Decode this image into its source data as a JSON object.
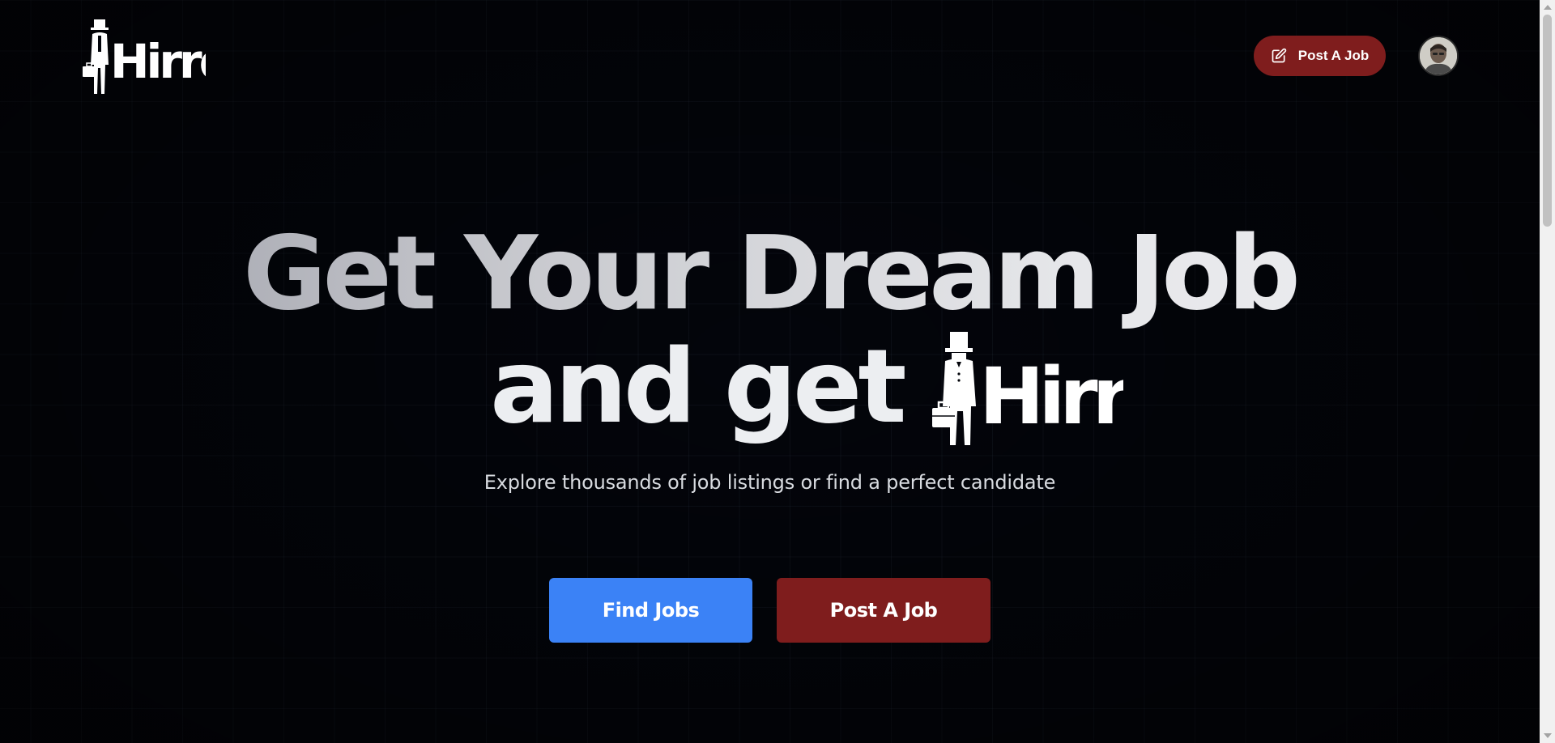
{
  "header": {
    "logo_text": "Hirrd",
    "post_job_label": "Post A Job"
  },
  "hero": {
    "headline_line1": "Get Your Dream Job",
    "headline_line2": "and get",
    "logo_text": "Hirrd",
    "subtitle": "Explore thousands of job listings or find a perfect candidate"
  },
  "actions": {
    "find_jobs_label": "Find Jobs",
    "post_job_label": "Post A Job"
  },
  "colors": {
    "background": "#03050b",
    "primary_blue": "#3b82f6",
    "accent_red": "#7f1d1d",
    "text": "#eceef1"
  },
  "icons": {
    "post_button_icon": "pencil-square-icon",
    "scroll_up": "chevron-up-icon",
    "scroll_down": "chevron-down-icon"
  }
}
